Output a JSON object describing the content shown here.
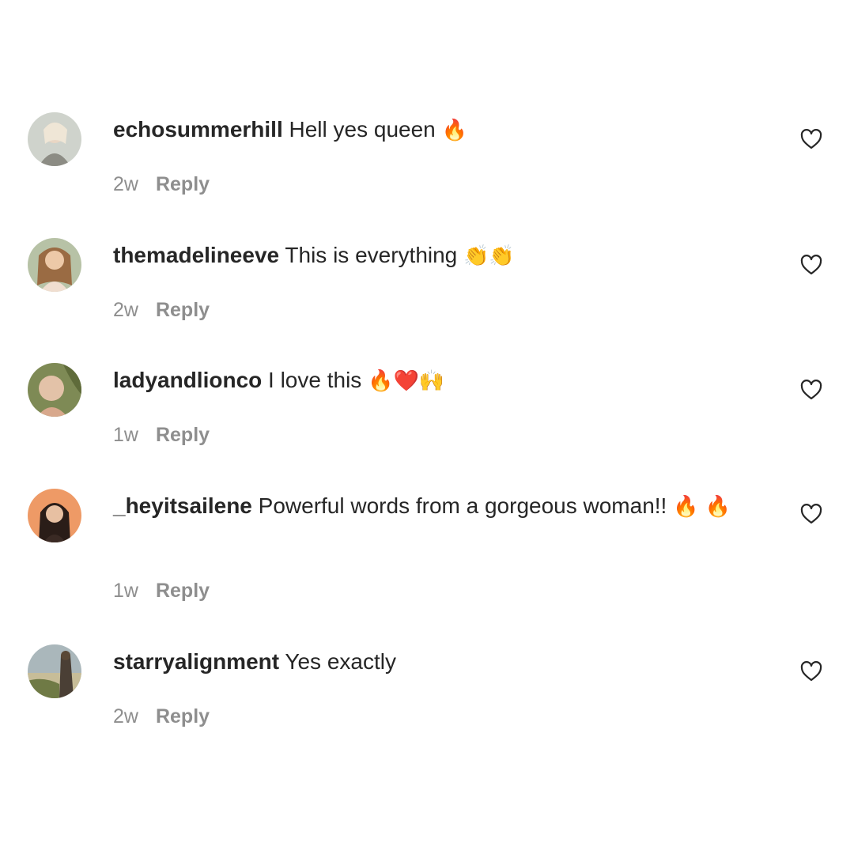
{
  "comments": [
    {
      "username": "echosummerhill",
      "text": "Hell yes queen",
      "emoji": "🔥",
      "time": "2w",
      "reply_label": "Reply",
      "avatar_colors": [
        "#a8a39a",
        "#e8e2d8"
      ]
    },
    {
      "username": "themadelineeve",
      "text": "This is everything",
      "emoji": "👏👏",
      "time": "2w",
      "reply_label": "Reply",
      "avatar_colors": [
        "#b08d6e",
        "#e9d2b4"
      ]
    },
    {
      "username": "ladyandlionco",
      "text": "I love this",
      "emoji": "🔥❤️🙌",
      "time": "1w",
      "reply_label": "Reply",
      "avatar_colors": [
        "#6f7c4e",
        "#d9b8a0"
      ]
    },
    {
      "username": "_heyitsailene",
      "text": "Powerful words from a gorgeous woman!!",
      "emoji": "🔥 🔥",
      "time": "1w",
      "reply_label": "Reply",
      "avatar_colors": [
        "#e89a6a",
        "#2a1f1c"
      ]
    },
    {
      "username": "starryalignment",
      "text": "Yes exactly",
      "emoji": "",
      "time": "2w",
      "reply_label": "Reply",
      "avatar_colors": [
        "#9aa8ad",
        "#5b5a3e"
      ]
    }
  ],
  "colors": {
    "primary_text": "#262626",
    "secondary_text": "#8e8e8e",
    "background": "#ffffff"
  },
  "icons": {
    "like": "heart-outline-icon"
  }
}
